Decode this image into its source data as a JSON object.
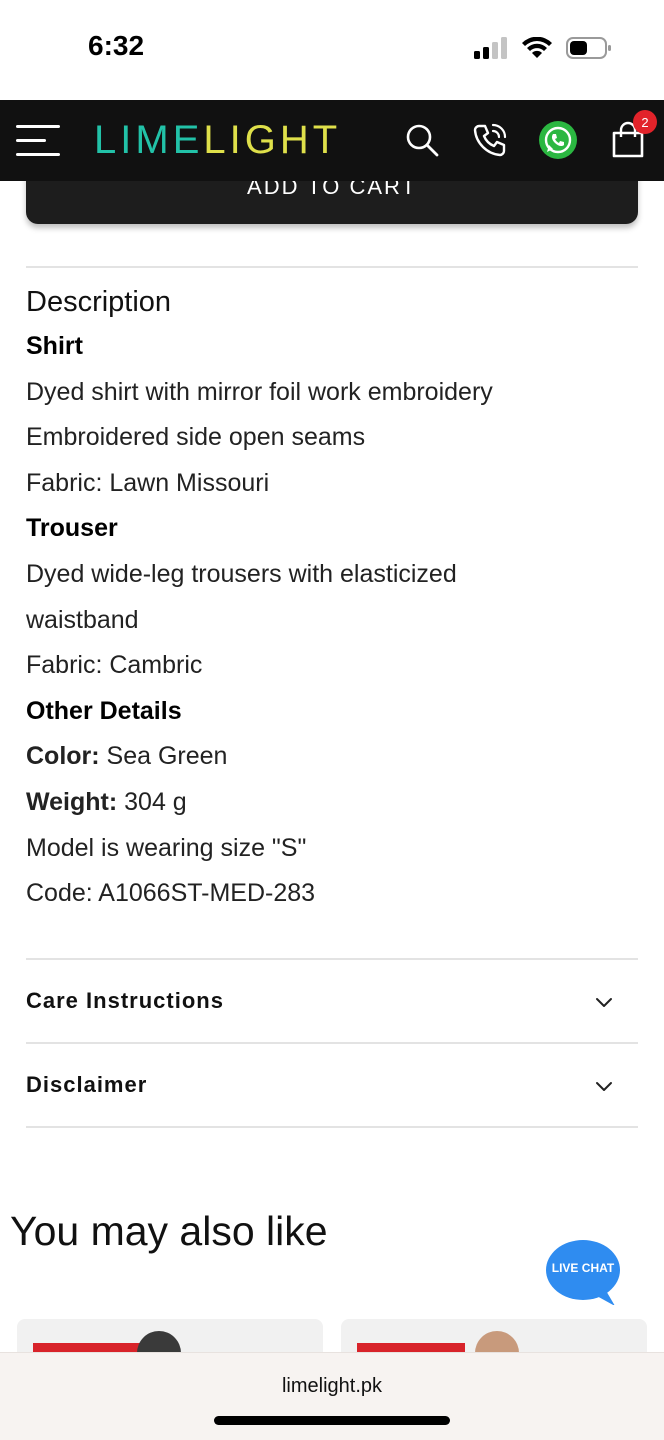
{
  "status_bar": {
    "time": "6:32"
  },
  "header": {
    "logo_part1": "LI",
    "logo_part2": "M",
    "logo_part3": "E",
    "logo_part4": "LIGHT",
    "cart_count": "2",
    "logo_colors": {
      "teal": "#22c2a8",
      "yellow": "#dfe04a"
    },
    "icons": [
      "menu-icon",
      "search-icon",
      "phone-icon",
      "whatsapp-icon",
      "shopping-bag-icon"
    ]
  },
  "product": {
    "add_to_cart_label": "ADD TO CART"
  },
  "description": {
    "heading": "Description",
    "lines": [
      {
        "label": "Shirt"
      },
      {
        "text": "Dyed shirt with mirror foil work embroidery"
      },
      {
        "text": "Embroidered side open seams"
      },
      {
        "text": "Fabric: Lawn Missouri"
      },
      {
        "label": "Trouser"
      },
      {
        "text": "Dyed wide-leg trousers with elasticized"
      },
      {
        "text": "waistband"
      },
      {
        "text": "Fabric: Cambric"
      },
      {
        "label": "Other Details"
      },
      {
        "key": "Color:",
        "value": " Sea Green"
      },
      {
        "key": "Weight:",
        "value": " 304 g"
      },
      {
        "text": "Model is wearing size \"S\""
      },
      {
        "text": "Code: A1066ST-MED-283"
      }
    ]
  },
  "accordions": [
    {
      "label": "Care Instructions"
    },
    {
      "label": "Disclaimer"
    }
  ],
  "recommendations": {
    "heading": "You may also like"
  },
  "live_chat": {
    "label": "LIVE CHAT",
    "color": "#2f8cf0"
  },
  "browser": {
    "url": "limelight.pk"
  }
}
